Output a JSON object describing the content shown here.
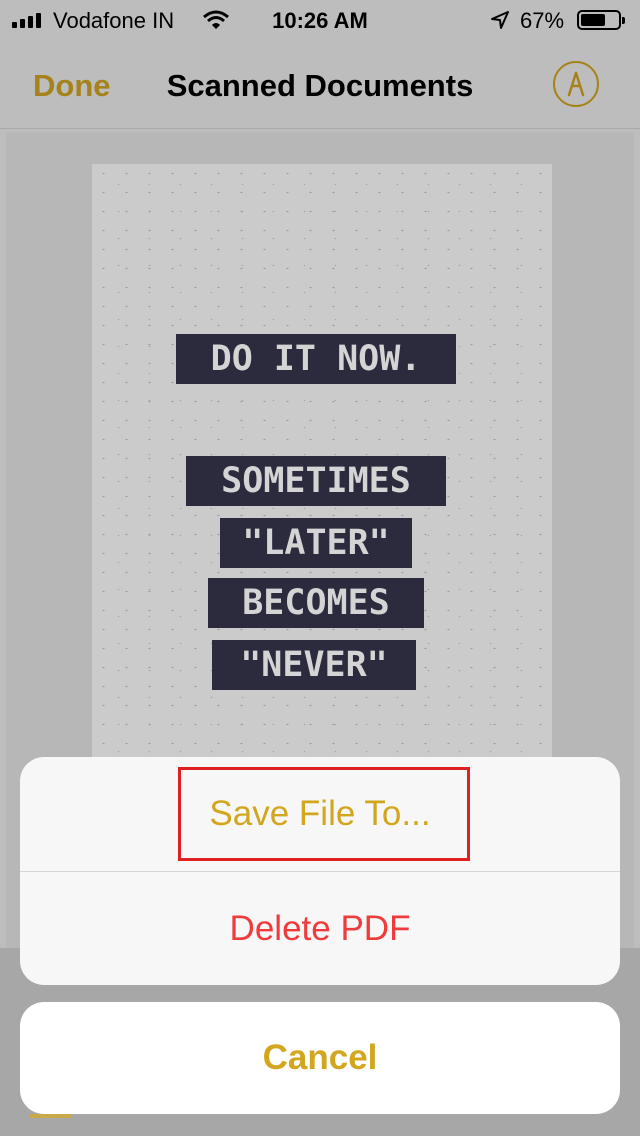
{
  "status_bar": {
    "carrier": "Vodafone IN",
    "time": "10:26 AM",
    "battery_percent": "67%",
    "battery_level": 0.67,
    "icons": [
      "signal-bars-icon",
      "wifi-icon",
      "location-arrow-icon",
      "battery-icon"
    ]
  },
  "nav": {
    "done_label": "Done",
    "title": "Scanned Documents",
    "markup_icon": "markup-pen-icon"
  },
  "document": {
    "lines": [
      "DO IT NOW.",
      "SOMETIMES",
      "\"LATER\"",
      "BECOMES",
      "\"NEVER\""
    ]
  },
  "action_sheet": {
    "save_label": "Save File To...",
    "delete_label": "Delete PDF",
    "cancel_label": "Cancel"
  },
  "colors": {
    "accent": "#d2a61e",
    "destructive": "#ef3b3b",
    "highlight_box": "#e02020"
  }
}
